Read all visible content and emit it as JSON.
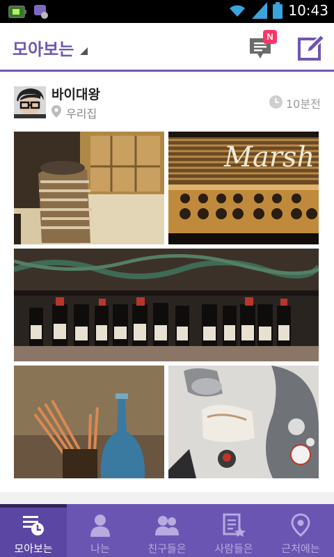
{
  "status_bar": {
    "time": "10:43"
  },
  "header": {
    "title": "모아보는",
    "news_badge": "N"
  },
  "post": {
    "author": "바이대왕",
    "location": "우리집",
    "time": "10분전"
  },
  "tabs": [
    {
      "label": "모아보는",
      "icon": "timeline-icon",
      "active": true
    },
    {
      "label": "나는",
      "icon": "person-icon",
      "active": false
    },
    {
      "label": "친구들은",
      "icon": "friends-icon",
      "active": false
    },
    {
      "label": "사람들은",
      "icon": "people-star-icon",
      "active": false
    },
    {
      "label": "근처에는",
      "icon": "location-pin-icon",
      "active": false
    }
  ],
  "colors": {
    "accent": "#6b55b3",
    "badge": "#ff3465",
    "status_bar": "#000000"
  }
}
